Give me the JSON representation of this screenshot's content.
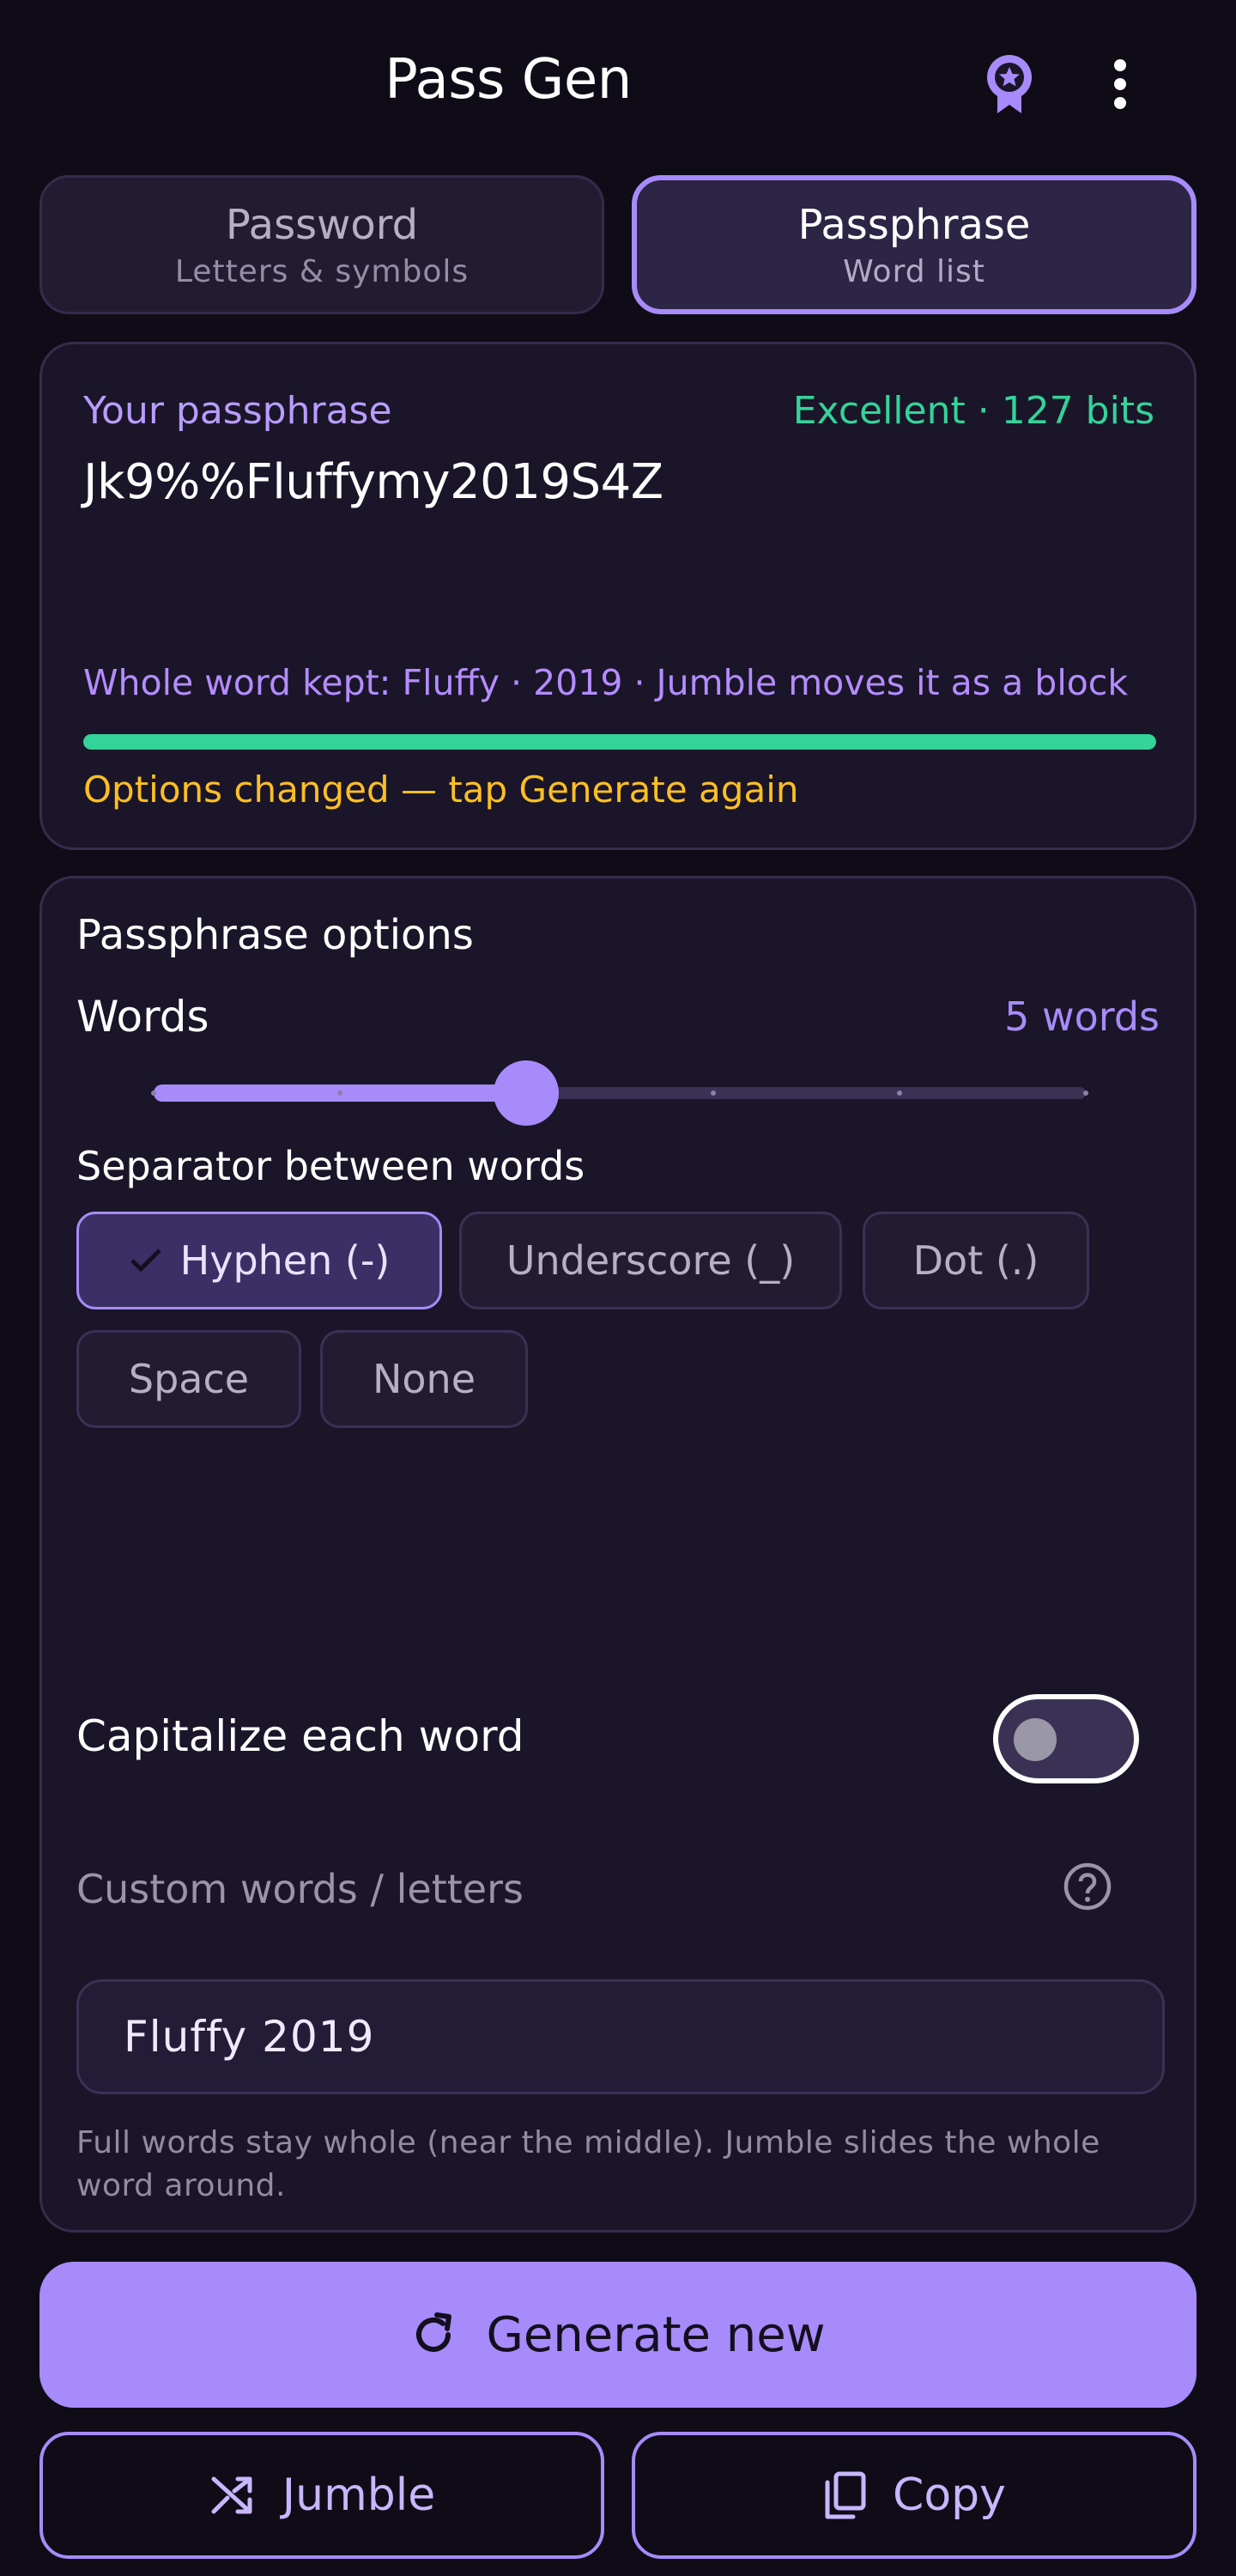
{
  "header": {
    "title": "Pass Gen",
    "award_icon": "award-badge-icon",
    "more_icon": "more-vertical-icon"
  },
  "mode_tabs": [
    {
      "label": "Password",
      "sub": "Letters & symbols",
      "selected": false
    },
    {
      "label": "Passphrase",
      "sub": "Word list",
      "selected": true
    }
  ],
  "result": {
    "label": "Your passphrase",
    "strength": "Excellent · 127 bits",
    "value": "Jk9%%Fluffymy2019S4Z",
    "kept_note": "Whole word kept: Fluffy · 2019  ·  Jumble moves it as a block",
    "strength_fraction": 1.0,
    "changed_note": "Options changed — tap Generate again"
  },
  "options": {
    "title": "Passphrase options",
    "words_label": "Words",
    "words_value": "5 words",
    "slider": {
      "min": 3,
      "max": 8,
      "value": 5
    },
    "separator_label": "Separator between words",
    "separators": [
      {
        "label": "Hyphen (-)",
        "selected": true
      },
      {
        "label": "Underscore (_)",
        "selected": false
      },
      {
        "label": "Dot (.)",
        "selected": false
      },
      {
        "label": "Space",
        "selected": false
      },
      {
        "label": "None",
        "selected": false
      }
    ],
    "capitalize_label": "Capitalize each word",
    "capitalize_on": false,
    "custom_label": "Custom words / letters",
    "custom_value": "Fluffy 2019",
    "helper": "Full words stay whole (near the middle). Jumble slides the whole word around."
  },
  "actions": {
    "generate": "Generate new",
    "jumble": "Jumble",
    "copy": "Copy"
  },
  "colors": {
    "accent": "#a78bfa",
    "strength_green": "#34d399",
    "warning_amber": "#fbbf24",
    "background": "#0f0c18"
  }
}
